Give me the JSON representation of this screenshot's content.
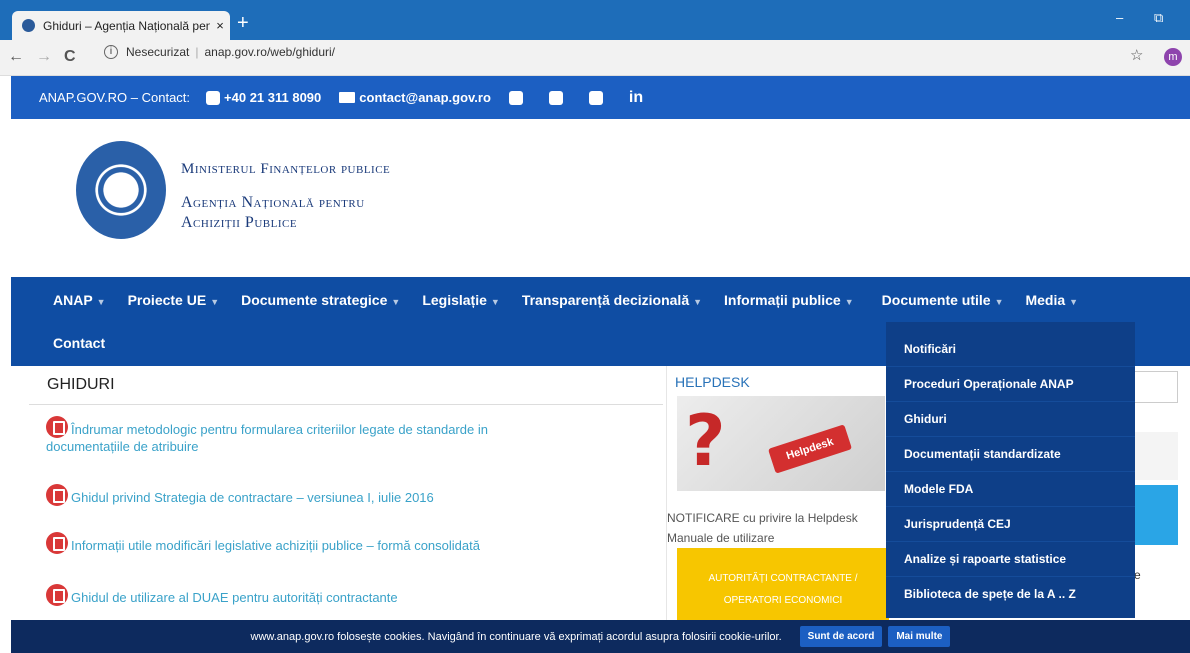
{
  "browser": {
    "tab_title": "Ghiduri – Agenția Națională pent",
    "tab_close": "×",
    "new_tab": "+",
    "minimize": "–",
    "restore": "⧉",
    "back": "←",
    "forward": "→",
    "reload": "C",
    "security_label": "Nesecurizat",
    "url": "anap.gov.ro/web/ghiduri/",
    "star": "☆",
    "avatar_letter": "m"
  },
  "contact": {
    "label": "ANAP.GOV.RO – Contact:",
    "phone": "+40 21 311 8090",
    "email": "contact@anap.gov.ro",
    "linkedin": "in"
  },
  "header": {
    "ministry": "Ministerul Finanțelor publice",
    "agency_line1": "Agenția Națională pentru",
    "agency_line2": "Achiziții Publice"
  },
  "nav": {
    "items": [
      {
        "label": "ANAP"
      },
      {
        "label": "Proiecte UE"
      },
      {
        "label": "Documente strategice"
      },
      {
        "label": "Legislație"
      },
      {
        "label": "Transparență decizională"
      },
      {
        "label": "Informații publice"
      },
      {
        "label": "Documente utile"
      },
      {
        "label": "Media"
      }
    ],
    "contact": "Contact"
  },
  "dropdown": {
    "items": [
      {
        "label": "Notificări"
      },
      {
        "label": "Proceduri Operaționale ANAP"
      },
      {
        "label": "Ghiduri"
      },
      {
        "label": "Documentații standardizate"
      },
      {
        "label": "Modele FDA"
      },
      {
        "label": "Jurisprudență CEJ"
      },
      {
        "label": "Analize și rapoarte statistice"
      },
      {
        "label": "Biblioteca de spețe de la A .. Z"
      }
    ]
  },
  "main": {
    "title": "GHIDURI",
    "docs": [
      {
        "line1": "Îndrumar metodologic pentru formularea criteriilor legate de standarde in",
        "line2": "documentațiile de atribuire"
      },
      {
        "line1": "Ghidul privind Strategia de contractare – versiunea I, iulie 2016"
      },
      {
        "line1": "Informații utile modificări legislative achiziții publice – formă consolidată"
      },
      {
        "line1": "Ghidul de utilizare al DUAE pentru autorități contractante"
      }
    ]
  },
  "helpdesk": {
    "title": "HELPDESK",
    "key_label": "Helpdesk",
    "note_line1": "NOTIFICARE cu privire la Helpdesk",
    "note_line2": "Manuale de utilizare",
    "yellow_line1": "AUTORITĂȚI CONTRACTANTE /",
    "yellow_line2": "OPERATORI ECONOMICI",
    "right_fragment": "e"
  },
  "cookies": {
    "text": "www.anap.gov.ro folosește cookies. Navigând în continuare vă exprimați acordul asupra folosirii cookie-urilor.",
    "accept": "Sunt de acord",
    "more": "Mai multe"
  }
}
